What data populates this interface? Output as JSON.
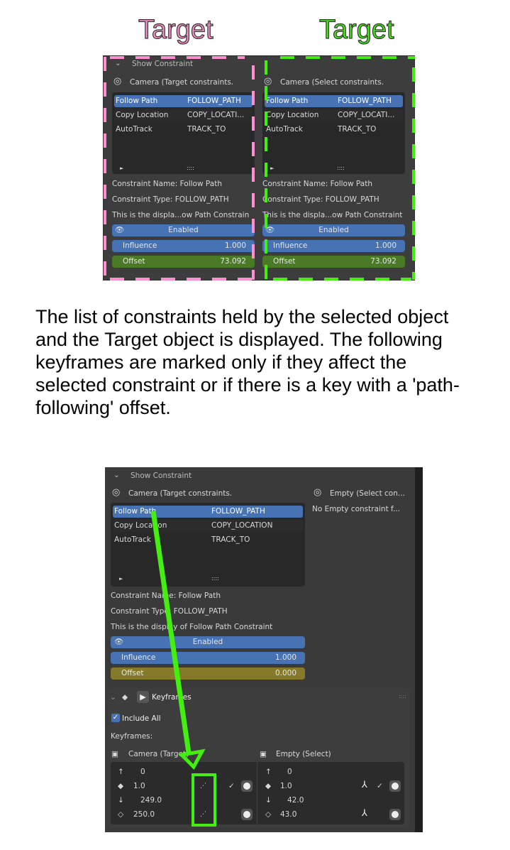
{
  "labels": {
    "target_left": "Target",
    "target_right": "Target",
    "colors": {
      "pink": "#ff8fcf",
      "green": "#44ee11"
    }
  },
  "top_panel": {
    "header": "Show Constraint",
    "columns": [
      {
        "title": "Camera (Target constraints.",
        "rows": [
          [
            "Follow Path",
            "FOLLOW_PATH"
          ],
          [
            "Copy Location",
            "COPY_LOCATI..."
          ],
          [
            "AutoTrack",
            "TRACK_TO"
          ]
        ],
        "name_line": "Constraint Name: Follow Path",
        "type_line": "Constraint Type: FOLLOW_PATH",
        "desc_line": "This is the displa...ow Path Constrain",
        "enabled": "Enabled",
        "influence_label": "Influence",
        "influence": "1.000",
        "offset_label": "Offset",
        "offset": "73.092"
      },
      {
        "title": "Camera (Select constraints.",
        "rows": [
          [
            "Follow Path",
            "FOLLOW_PATH"
          ],
          [
            "Copy Location",
            "COPY_LOCATI..."
          ],
          [
            "AutoTrack",
            "TRACK_TO"
          ]
        ],
        "name_line": "Constraint Name: Follow Path",
        "type_line": "Constraint Type: FOLLOW_PATH",
        "desc_line": "This is the displa...ow Path Constraint",
        "enabled": "Enabled",
        "influence_label": "Influence",
        "influence": "1.000",
        "offset_label": "Offset",
        "offset": "73.092"
      }
    ],
    "list_grip": "::::"
  },
  "description": "The list of constraints held by the selected object and the Target object is displayed. The following keyframes are marked only if they affect the selected constraint or if there is a key with a 'path-following' offset.",
  "bottom_panel": {
    "header": "Show Constraint",
    "camera_title": "Camera (Target constraints.",
    "empty_title": "Empty (Select con...",
    "empty_note": "No Empty constraint f...",
    "rows": [
      [
        "Follow Path",
        "FOLLOW_PATH"
      ],
      [
        "Copy Location",
        "COPY_LOCATION"
      ],
      [
        "AutoTrack",
        "TRACK_TO"
      ]
    ],
    "list_grip": "::::",
    "name_line": "Constraint Name: Follow Path",
    "type_line": "Constraint Type: FOLLOW_PATH",
    "desc_line": "This is the display of Follow Path Constraint",
    "enabled": "Enabled",
    "influence_label": "Influence",
    "influence": "1.000",
    "offset_label": "Offset",
    "offset": "0.000",
    "keyframes": {
      "header": "Keyframes",
      "include_all": "Include All",
      "include_all_checked": true,
      "section_label": "Keyframes:",
      "camera_label": "Camera (Target)",
      "empty_label": "Empty (Select)",
      "camera_values": [
        "0",
        "1.0",
        "249.0",
        "250.0"
      ],
      "empty_values": [
        "0",
        "1.0",
        "42.0",
        "43.0"
      ]
    }
  }
}
